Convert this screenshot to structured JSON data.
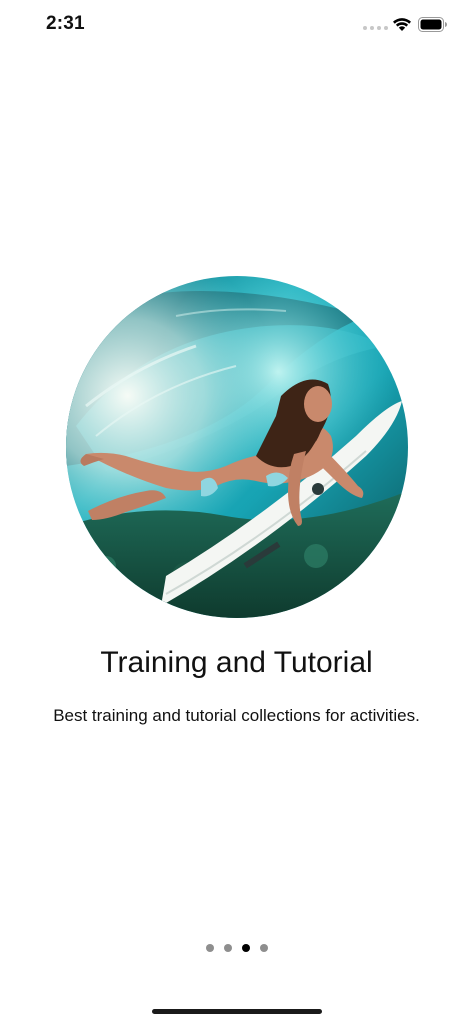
{
  "status_bar": {
    "time": "2:31"
  },
  "onboarding": {
    "image": "surfer-underwater-photo",
    "title": "Training and Tutorial",
    "subtitle": "Best training and tutorial collections for activities.",
    "pager": {
      "total": 4,
      "active_index": 2
    }
  },
  "colors": {
    "background": "#ffffff",
    "text": "#111111",
    "dot_inactive": "#8e8e8e",
    "dot_active": "#000000"
  }
}
